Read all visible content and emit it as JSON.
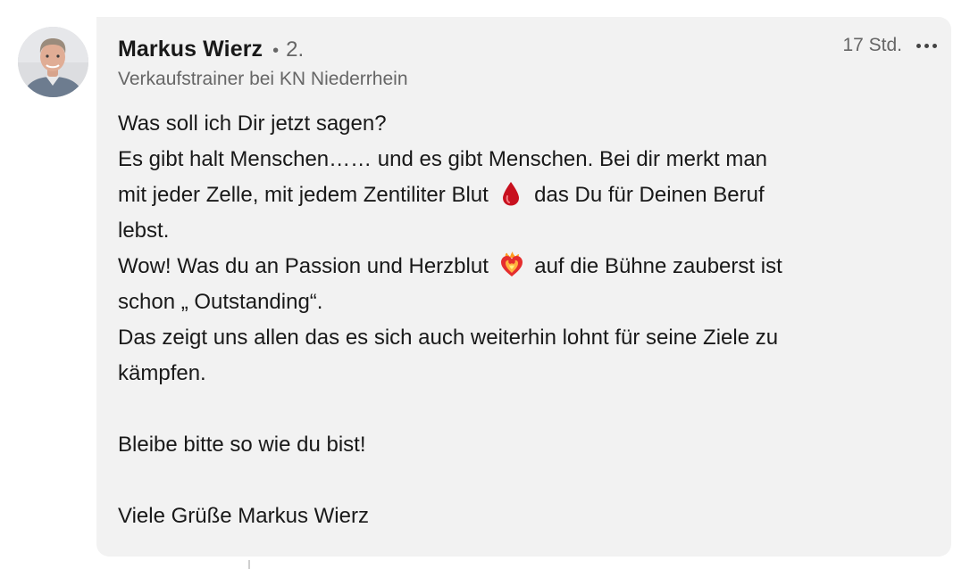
{
  "author": {
    "name": "Markus Wierz",
    "separator": "•",
    "degree": "2.",
    "headline": "Verkaufstrainer bei KN Niederrhein"
  },
  "comment": {
    "timestamp": "17 Std.",
    "lines": {
      "l1": "Was soll ich Dir jetzt sagen?",
      "l2": "Es gibt halt Menschen…… und es gibt Menschen. Bei dir merkt man",
      "l3a": "mit jeder Zelle, mit jedem Zentiliter Blut",
      "l3b": "das Du für Deinen Beruf",
      "l4": "lebst.",
      "l5a": "Wow! Was du an Passion und Herzblut",
      "l5b": "auf die Bühne zauberst ist",
      "l6": "schon „ Outstanding“.",
      "l7": "Das zeigt uns allen das es sich auch weiterhin lohnt für seine Ziele zu",
      "l8": "kämpfen.",
      "l9": "Bleibe bitte so wie du bist!",
      "l10": "Viele Grüße Markus Wierz"
    },
    "emojis": {
      "drop": "drop-of-blood-icon",
      "heart": "heart-on-fire-icon"
    }
  },
  "icons": {
    "more": "more-options-icon",
    "avatar": "profile-photo"
  },
  "colors": {
    "bubble": "#f2f2f2",
    "text": "#191919",
    "muted": "#666666"
  }
}
